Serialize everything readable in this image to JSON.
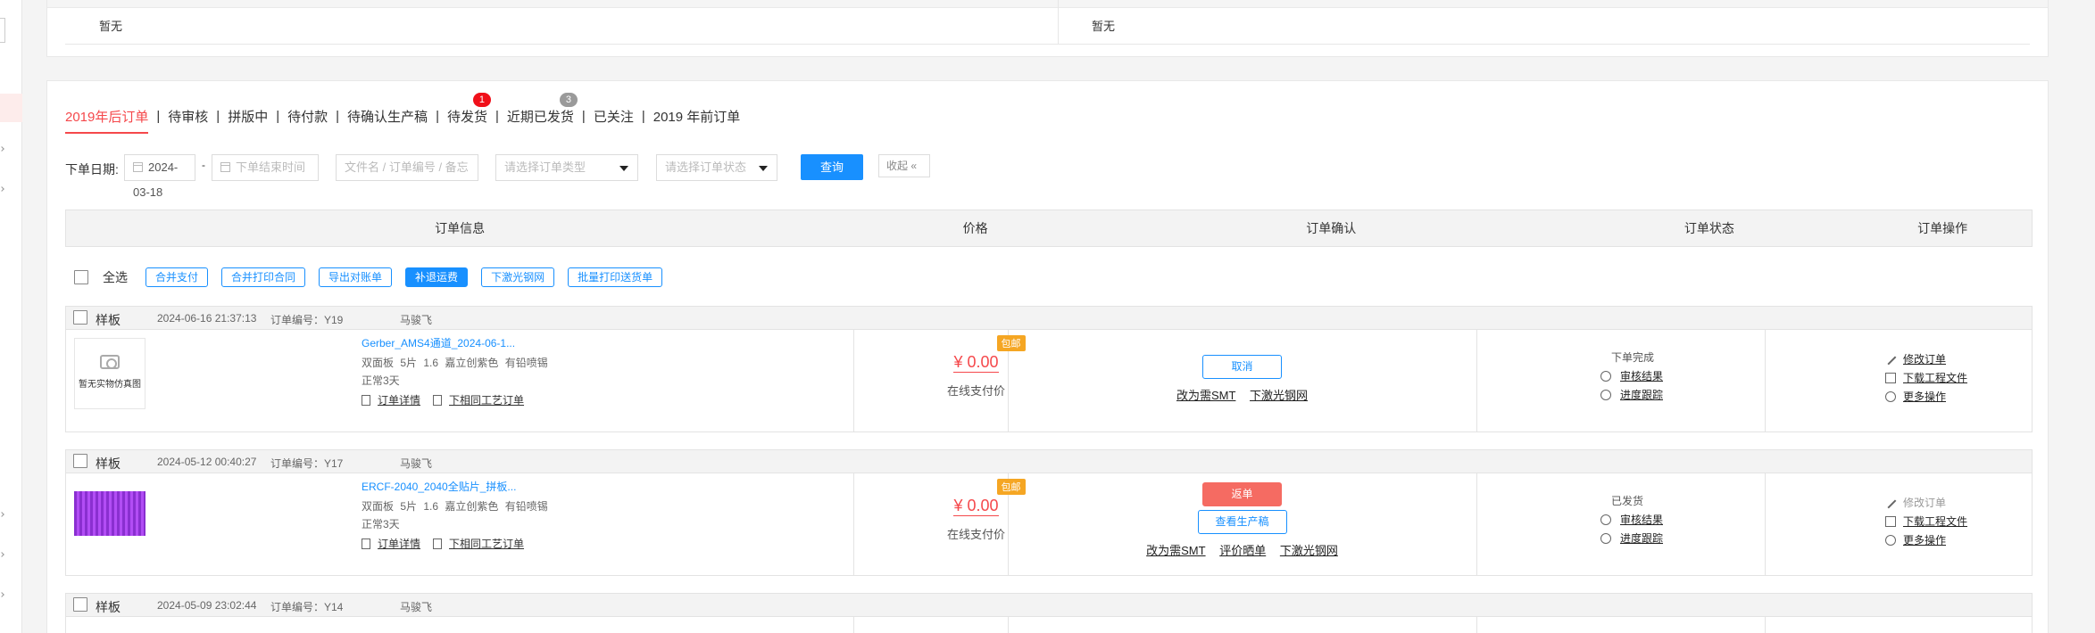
{
  "top": {
    "left_value": "暂无",
    "right_value": "暂无"
  },
  "tabs": [
    {
      "label": "2019年后订单",
      "active": true
    },
    {
      "label": "待审核"
    },
    {
      "label": "拼版中"
    },
    {
      "label": "待付款"
    },
    {
      "label": "待确认生产稿"
    },
    {
      "label": "待发货",
      "badge": "1"
    },
    {
      "label": "近期已发货",
      "badge": "3"
    },
    {
      "label": "已关注"
    },
    {
      "label": "2019 年前订单"
    }
  ],
  "filters": {
    "date_label": "下单日期:",
    "start_date": "2024-03-18",
    "dash": "-",
    "end_placeholder": "下单结束时间",
    "keyword_placeholder": "文件名 / 订单编号 / 备忘",
    "type_placeholder": "请选择订单类型",
    "status_placeholder": "请选择订单状态",
    "query_label": "查询",
    "collapse_label": "收起"
  },
  "table_header": [
    "订单信息",
    "价格",
    "订单确认",
    "订单状态",
    "订单操作"
  ],
  "batch": {
    "select_all": "全选",
    "buttons": [
      "合并支付",
      "合并打印合同",
      "导出对账单",
      "补退运费",
      "下激光钢网",
      "批量打印送货单"
    ]
  },
  "orders": [
    {
      "type": "样板",
      "time": "2024-06-16 21:37:13",
      "no": "订单编号：Y19",
      "owner": "马骏飞",
      "thumb_text": "暂无实物仿真图",
      "file": "Gerber_AMS4通道_2024-06-1...",
      "specs": "双面板 5片 1.6 嘉立创紫色 有铅喷锡",
      "days": "正常3天",
      "link1": "订单详情",
      "link2": "下相同工艺订单",
      "price": "¥ 0.00",
      "free": "包邮",
      "price_sub": "在线支付价",
      "confirm_buttons": [
        "取消"
      ],
      "confirm_links": [
        "改为需SMT",
        "下激光钢网"
      ],
      "status": "下单完成",
      "status_links": [
        "审核结果",
        "进度跟踪"
      ],
      "ops": [
        "修改订单",
        "下载工程文件",
        "更多操作"
      ]
    },
    {
      "type": "样板",
      "time": "2024-05-12 00:40:27",
      "no": "订单编号：Y17",
      "owner": "马骏飞",
      "file": "ERCF-2040_2040全贴片_拼板...",
      "specs": "双面板 5片 1.6 嘉立创紫色 有铅喷锡",
      "days": "正常3天",
      "link1": "订单详情",
      "link2": "下相同工艺订单",
      "price": "¥ 0.00",
      "free": "包邮",
      "price_sub": "在线支付价",
      "confirm_buttons": [
        "返单",
        "查看生产稿"
      ],
      "confirm_links": [
        "改为需SMT",
        "评价晒单",
        "下激光钢网"
      ],
      "status": "已发货",
      "status_links": [
        "审核结果",
        "进度跟踪"
      ],
      "ops": [
        "修改订单",
        "下载工程文件",
        "更多操作"
      ]
    },
    {
      "type": "样板",
      "time": "2024-05-09 23:02:44",
      "no": "订单编号：Y14",
      "owner": "马骏飞"
    }
  ]
}
